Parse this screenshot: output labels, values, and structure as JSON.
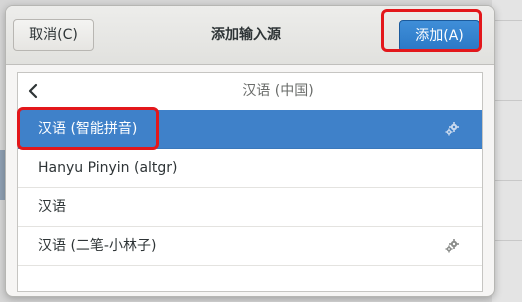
{
  "dialog": {
    "title": "添加输入源",
    "cancel_label": "取消(C)",
    "add_label": "添加(A)"
  },
  "list": {
    "header_title": "汉语 (中国)",
    "items": [
      {
        "label": "汉语 (智能拼音)",
        "selected": true,
        "icon": "gear-icon"
      },
      {
        "label": "Hanyu Pinyin (altgr)",
        "selected": false,
        "icon": null
      },
      {
        "label": "汉语",
        "selected": false,
        "icon": null
      },
      {
        "label": "汉语 (二笔-小林子)",
        "selected": false,
        "icon": "gear-icon"
      }
    ]
  },
  "colors": {
    "accent": "#3f81c9",
    "highlight": "#e3171b"
  }
}
